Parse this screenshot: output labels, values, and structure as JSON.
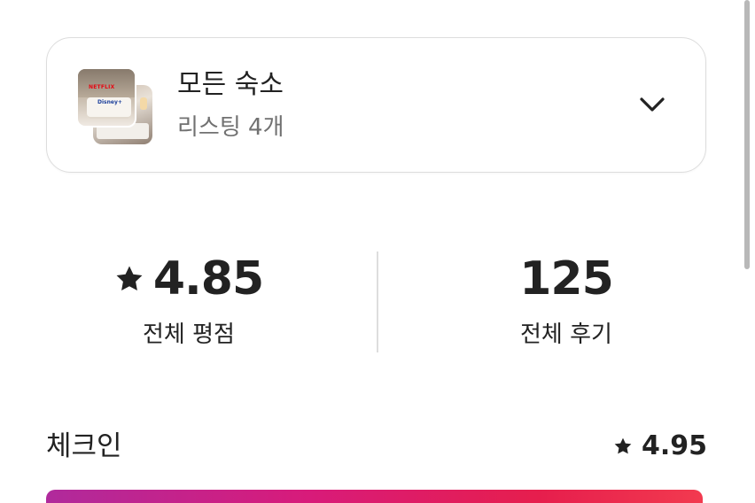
{
  "listing_selector": {
    "title": "모든 숙소",
    "subtitle": "리스팅 4개",
    "thumbnail_text": {
      "brand_top": "NETFLIX",
      "brand_bottom": "Disney+"
    },
    "expand_icon": "chevron-down-icon"
  },
  "stats": {
    "overall_rating": {
      "value": "4.85",
      "label": "전체 평점",
      "icon": "star-icon"
    },
    "total_reviews": {
      "value": "125",
      "label": "전체 후기"
    }
  },
  "categories": [
    {
      "label": "체크인",
      "score": "4.95",
      "bar_fill": 0.99
    }
  ],
  "colors": {
    "text_primary": "#222222",
    "text_secondary": "#717171",
    "border": "#dddddd",
    "bar_gradient_start": "#b02a9c",
    "bar_gradient_end": "#f23a4f"
  }
}
